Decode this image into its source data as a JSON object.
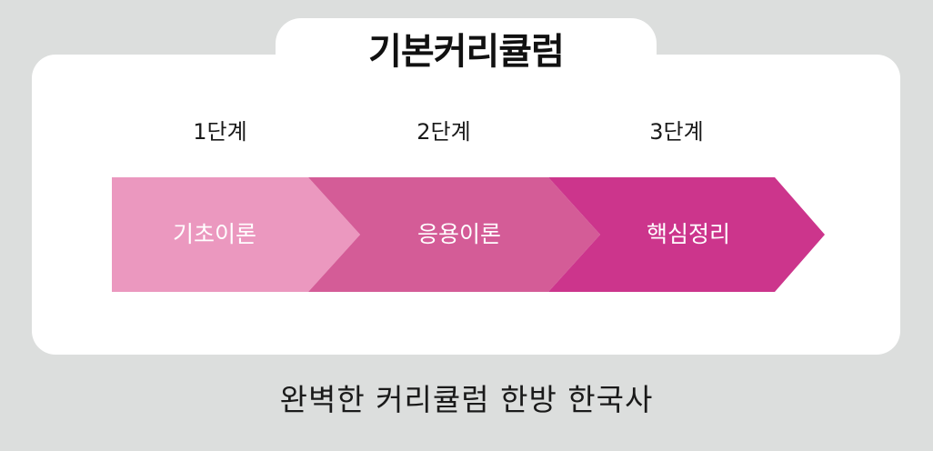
{
  "title": "기본커리큘럼",
  "stages": [
    {
      "step": "1단계",
      "label": "기초이론",
      "color": "#eb98bf"
    },
    {
      "step": "2단계",
      "label": "응용이론",
      "color": "#d45c97"
    },
    {
      "step": "3단계",
      "label": "핵심정리",
      "color": "#cc358c"
    }
  ],
  "tagline": "완벽한 커리큘럼 한방 한국사"
}
